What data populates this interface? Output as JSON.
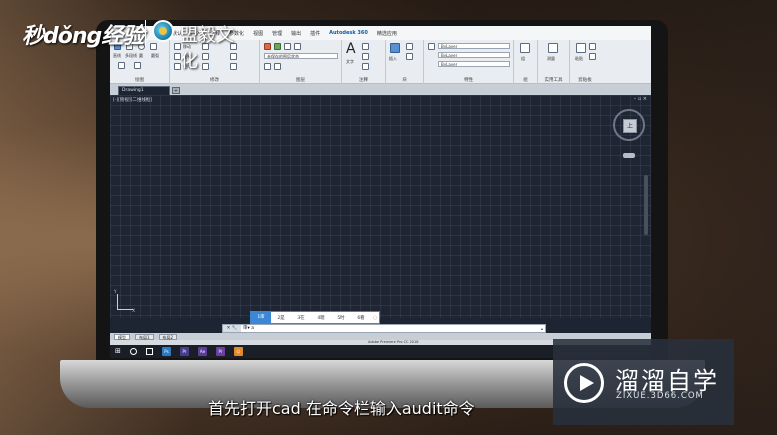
{
  "brand": {
    "logo_text": "秒dǒng经验",
    "org_name": "盟毅文化"
  },
  "ribbon": {
    "tabs": [
      {
        "label": "默认",
        "active": false
      },
      {
        "label": "插入",
        "active": false
      },
      {
        "label": "注释",
        "active": false
      },
      {
        "label": "参数化",
        "active": false
      },
      {
        "label": "视图",
        "active": false
      },
      {
        "label": "管理",
        "active": false
      },
      {
        "label": "输出",
        "active": false
      },
      {
        "label": "插件",
        "active": false
      },
      {
        "label": "Autodesk 360",
        "active": true
      },
      {
        "label": "精选应用",
        "active": false
      }
    ],
    "groups": [
      "绘图",
      "修改",
      "图层",
      "注释",
      "块",
      "特性",
      "组",
      "实用工具",
      "剪贴板"
    ],
    "layer_dropdown": "未保存的图层状态",
    "property_dropdowns": [
      "ByLayer",
      "ByLayer",
      "ByLayer"
    ],
    "draw_labels": [
      "直线",
      "多段线",
      "圆",
      "圆弧"
    ],
    "modify_labels": [
      "移动",
      "复制",
      "拉伸"
    ],
    "annotation_label": "文字",
    "insert_label": "插入",
    "util_labels": [
      "测量",
      "粘贴"
    ],
    "group_label": "组"
  },
  "document": {
    "tab_label": "Drawing1",
    "add_label": "+"
  },
  "canvas": {
    "view_label": "[-][俯视][二维线框]",
    "window_buttons": "– ▫ ×",
    "viewcube_face": "上",
    "ucs_x": "X",
    "ucs_y": "Y"
  },
  "ime": {
    "candidates": [
      "1审",
      "2是",
      "3在",
      "4嗯",
      "5时",
      "6看"
    ],
    "more": "◌"
  },
  "command_line": {
    "tools": "✕ 🔧",
    "prompt": "审▾ a",
    "arrow": "▴"
  },
  "layout_tabs": [
    "模型",
    "布局1",
    "布局2"
  ],
  "status": {
    "app_text": "Adobe Premiere Pro CC 2018"
  },
  "taskbar": {
    "start": "⊞",
    "apps": [
      {
        "label": "Ps",
        "color": "#2b7bc4"
      },
      {
        "label": "Pr",
        "color": "#4a3c8c"
      },
      {
        "label": "Ae",
        "color": "#5b3e9a"
      },
      {
        "label": "Pr",
        "color": "#6a3fa0"
      },
      {
        "label": "☺",
        "color": "#e08a2c"
      }
    ]
  },
  "subtitle": "首先打开cad 在命令栏输入audit命令",
  "watermark": {
    "title": "溜溜自学",
    "url": "ZIXUE.3D66.COM"
  }
}
